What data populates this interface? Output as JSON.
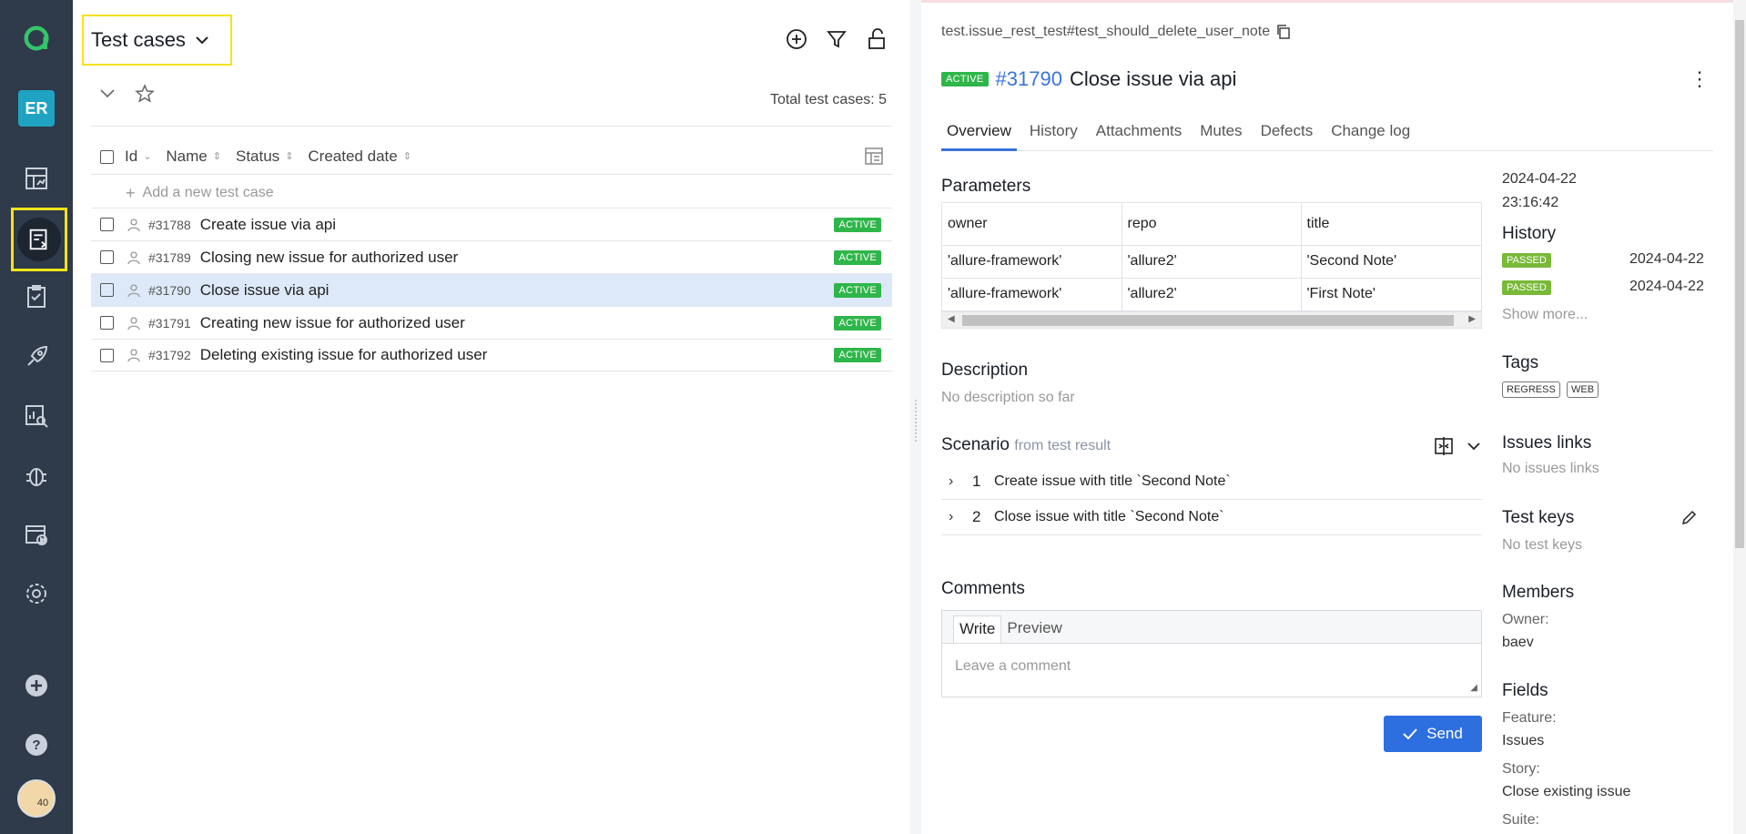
{
  "sidebar": {
    "user_initials": "ER",
    "avatar_text": "40"
  },
  "left_panel": {
    "title": "Test cases",
    "total_label": "Total test cases: 5",
    "columns": [
      "Id",
      "Name",
      "Status",
      "Created date"
    ],
    "add_placeholder": "Add a new test case",
    "rows": [
      {
        "id": "#31788",
        "name": "Create issue via api",
        "status": "ACTIVE",
        "selected": false
      },
      {
        "id": "#31789",
        "name": "Closing new issue for authorized user",
        "status": "ACTIVE",
        "selected": false
      },
      {
        "id": "#31790",
        "name": "Close issue via api",
        "status": "ACTIVE",
        "selected": true
      },
      {
        "id": "#31791",
        "name": "Creating new issue for authorized user",
        "status": "ACTIVE",
        "selected": false
      },
      {
        "id": "#31792",
        "name": "Deleting existing issue for authorized user",
        "status": "ACTIVE",
        "selected": false
      }
    ]
  },
  "detail": {
    "path": "test.issue_rest_test#test_should_delete_user_note",
    "status": "ACTIVE",
    "id": "#31790",
    "title": "Close issue via api",
    "tabs": [
      "Overview",
      "History",
      "Attachments",
      "Mutes",
      "Defects",
      "Change log"
    ],
    "parameters": {
      "heading": "Parameters",
      "headers": [
        "owner",
        "repo",
        "title"
      ],
      "rows": [
        [
          "'allure-framework'",
          "'allure2'",
          "'Second Note'"
        ],
        [
          "'allure-framework'",
          "'allure2'",
          "'First Note'"
        ]
      ]
    },
    "description": {
      "heading": "Description",
      "text": "No description so far"
    },
    "scenario": {
      "heading": "Scenario",
      "subheading": "from test result",
      "steps": [
        {
          "num": "1",
          "text": "Create issue with title `Second Note`"
        },
        {
          "num": "2",
          "text": "Close issue with title `Second Note`"
        }
      ]
    },
    "comments": {
      "heading": "Comments",
      "tab_write": "Write",
      "tab_preview": "Preview",
      "placeholder": "Leave a comment",
      "send_label": "Send"
    },
    "side": {
      "date": "2024-04-22",
      "time": "23:16:42",
      "history_heading": "History",
      "history": [
        {
          "status": "PASSED",
          "date": "2024-04-22"
        },
        {
          "status": "PASSED",
          "date": "2024-04-22"
        }
      ],
      "show_more": "Show more...",
      "tags_heading": "Tags",
      "tags": [
        "REGRESS",
        "WEB"
      ],
      "issues_heading": "Issues links",
      "issues_text": "No issues links",
      "keys_heading": "Test keys",
      "keys_text": "No test keys",
      "members_heading": "Members",
      "owner_label": "Owner:",
      "owner_value": "baev",
      "fields_heading": "Fields",
      "feature_label": "Feature:",
      "feature_value": "Issues",
      "story_label": "Story:",
      "story_value": "Close existing issue",
      "suite_label": "Suite:"
    }
  },
  "colors": {
    "sidebar_bg": "#2f3a4a",
    "accent_blue": "#2e6fe0",
    "active_green": "#2fb64a",
    "passed_green": "#79b938",
    "highlight_yellow": "#f5e31a"
  }
}
